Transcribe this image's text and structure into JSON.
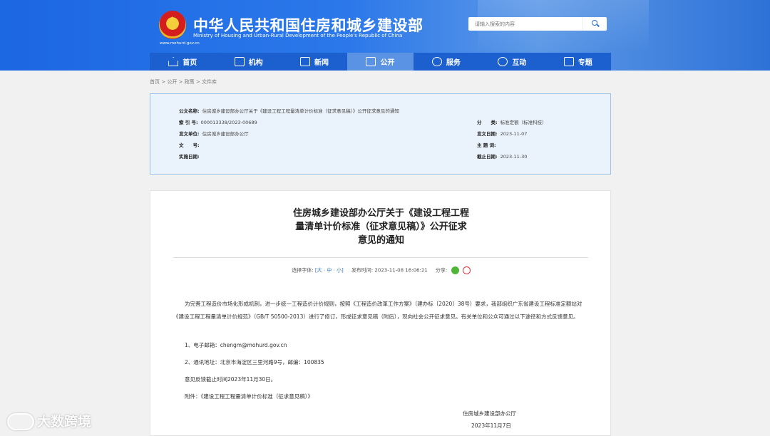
{
  "header": {
    "title": "中华人民共和国住房和城乡建设部",
    "subtitle": "Ministry of Housing and Urban-Rural Development of the People's Republic of China",
    "url": "www.mohurd.gov.cn",
    "search_placeholder": "请输入搜索的内容"
  },
  "nav": [
    {
      "label": "首页",
      "icon": "home-icon"
    },
    {
      "label": "机构",
      "icon": "org-icon"
    },
    {
      "label": "新闻",
      "icon": "news-icon"
    },
    {
      "label": "公开",
      "icon": "disclosure-icon",
      "active": true
    },
    {
      "label": "服务",
      "icon": "service-icon"
    },
    {
      "label": "互动",
      "icon": "interact-icon"
    },
    {
      "label": "专题",
      "icon": "topic-icon"
    }
  ],
  "breadcrumb": "首页 > 公开 > 政策 > 文件库",
  "info": {
    "doc_name_label": "公文名称:",
    "doc_name": "住房城乡建设部办公厅关于《建设工程工程量清单计价标准（征求意见稿）》公开征求意见的通知",
    "index_label": "索 引 号:",
    "index": "000013338/2023-00689",
    "category_label": "分　　类:",
    "category": "标准定额（标准科技）",
    "issuer_label": "发文单位:",
    "issuer": "住房城乡建设部办公厅",
    "date_label": "发文日期:",
    "date": "2023-11-07",
    "docno_label": "文　　号:",
    "docno": "",
    "subject_label": "主 题 词:",
    "subject": "",
    "impl_label": "实施日期:",
    "impl": "",
    "expire_label": "截止日期:",
    "expire": "2023-11-30"
  },
  "article": {
    "title_lines": [
      "住房城乡建设部办公厅关于《建设工程工程",
      "量清单计价标准（征求意见稿）》公开征求",
      "意见的通知"
    ],
    "font_label": "选择字体:",
    "font_options": "[大 · 中 · 小]",
    "publish_label": "发布时间:",
    "publish_time": "2023-11-08 16:06:21",
    "share_label": "分享:",
    "body": "为完善工程造价市场化形成机制，进一步统一工程造价计价规则，按照《工程造价改革工作方案》（建办标〔2020〕38号）要求，我部组织广东省建设工程标准定额站对《建设工程工程量清单计价规范》（GB/T 50500-2013）进行了修订，形成征求意见稿（附后），现向社会公开征求意见。有关单位和公众可通过以下途径和方式反馈意见。",
    "item1": "1、电子邮箱：chengm@mohurd.gov.cn",
    "item2": "2、通讯地址：北京市海淀区三里河路9号，邮编：100835",
    "deadline": "意见反馈截止时间2023年11月30日。",
    "attachment": "附件：《建设工程工程量清单计价标准（征求意见稿）》",
    "sign_org": "住房城乡建设部办公厅",
    "sign_date": "2023年11月7日"
  },
  "watermark": "大数跨境"
}
